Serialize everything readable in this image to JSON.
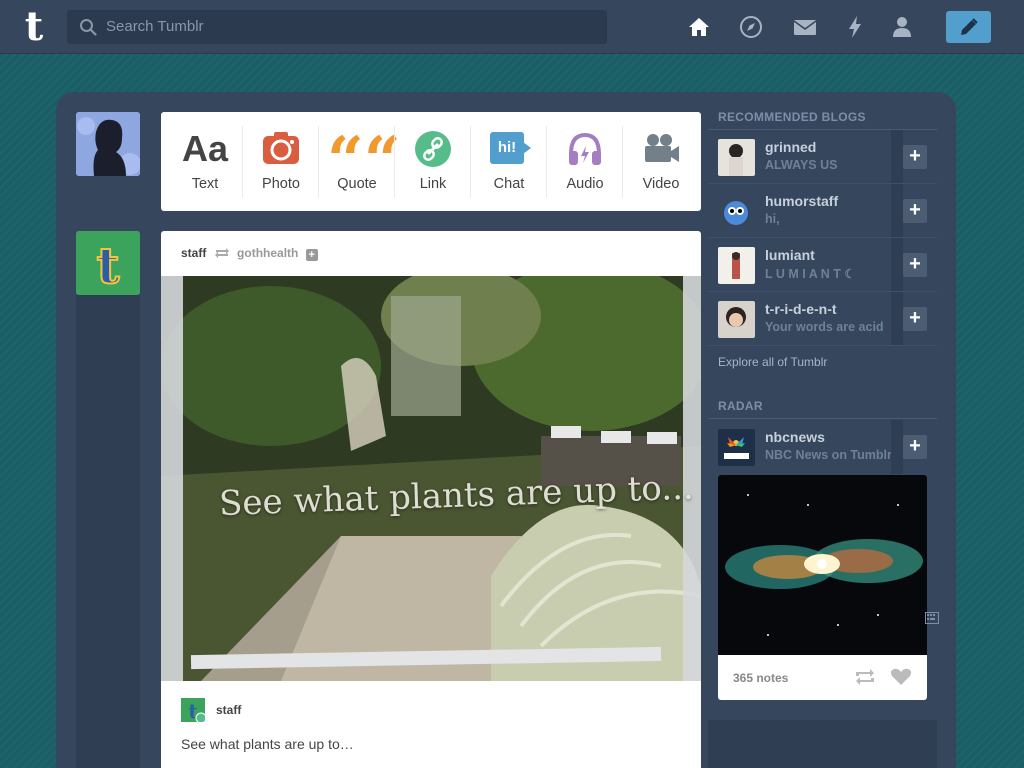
{
  "app": {
    "logo": "t"
  },
  "search": {
    "placeholder": "Search Tumblr"
  },
  "nav": {
    "icons": [
      "home-icon",
      "explore-icon",
      "inbox-icon",
      "activity-icon",
      "account-icon",
      "compose-icon"
    ]
  },
  "post_types": [
    {
      "label": "Text",
      "icon": "text-icon",
      "glyph": "Aa",
      "color": "#444444"
    },
    {
      "label": "Photo",
      "icon": "camera-icon",
      "color": "#d95e40"
    },
    {
      "label": "Quote",
      "icon": "quote-icon",
      "glyph": "““",
      "color": "#f2992e"
    },
    {
      "label": "Link",
      "icon": "link-icon",
      "color": "#56bc8a"
    },
    {
      "label": "Chat",
      "icon": "chat-icon",
      "glyph": "hi!",
      "color": "#529ecc"
    },
    {
      "label": "Audio",
      "icon": "headphones-icon",
      "color": "#a77dc2"
    },
    {
      "label": "Video",
      "icon": "video-camera-icon",
      "color": "#748089"
    }
  ],
  "post": {
    "author": "staff",
    "reblogged_from": "gothhealth",
    "image_caption": "See what plants are up to...",
    "footer_author": "staff",
    "body": "See what plants are up to…"
  },
  "sidebar": {
    "recommended_title": "RECOMMENDED BLOGS",
    "blogs": [
      {
        "name": "grinned",
        "subtitle": "ALWAYS US"
      },
      {
        "name": "humorstaff",
        "subtitle": "hi,"
      },
      {
        "name": "lumiant",
        "subtitle": "L U M I A N T ☾"
      },
      {
        "name": "t-r-i-d-e-n-t",
        "subtitle": "Your words are acid"
      }
    ],
    "follow_label": "+",
    "explore_link": "Explore all of Tumblr",
    "radar_title": "RADAR",
    "radar_blog": {
      "name": "nbcnews",
      "subtitle": "NBC News on Tumblr"
    },
    "radar_notes": "365 notes"
  },
  "colors": {
    "nav_bg": "#36465d",
    "page_bg": "#1b5f66",
    "accent": "#529ecc"
  }
}
